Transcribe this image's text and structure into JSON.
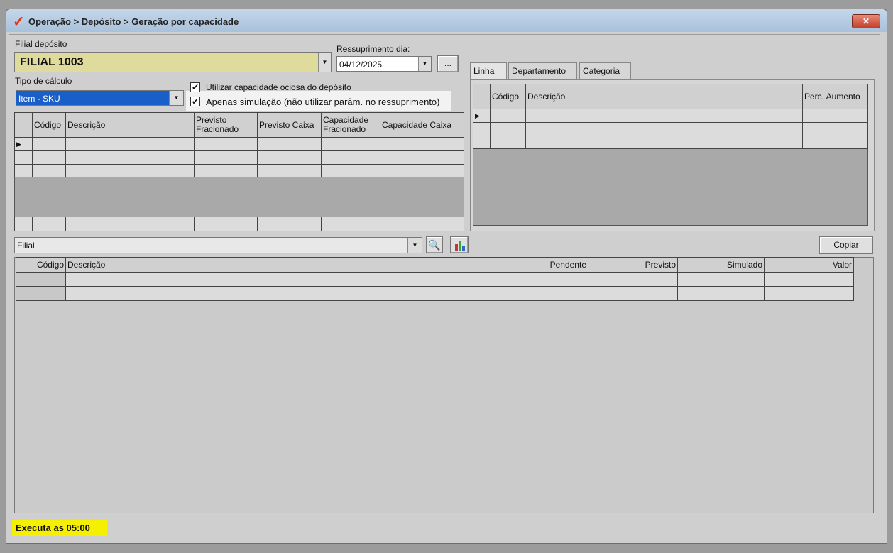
{
  "window": {
    "title": "Operação > Depósito > Geração por capacidade",
    "close": "✕"
  },
  "filial": {
    "label": "Filial depósito",
    "value": "FILIAL 1003"
  },
  "ressuprimento": {
    "label": "Ressuprimento dia:",
    "value": "04/12/2025",
    "button": "..."
  },
  "tipo": {
    "label": "Tipo de cálculo",
    "value": "Item - SKU"
  },
  "checks": [
    {
      "label": "Utilizar capacidade ociosa do depósito",
      "checked": true
    },
    {
      "label": "Apenas simulação (não utilizar parâm. no ressuprimento)",
      "checked": true
    }
  ],
  "grid1": {
    "headers": [
      "Código",
      "Descrição",
      "Previsto Fracionado",
      "Previsto Caixa",
      "Capacidade Fracionado",
      "Capacidade Caixa"
    ]
  },
  "tabs": [
    "Linha",
    "Departamento",
    "Categoria"
  ],
  "grid2": {
    "headers": [
      "Código",
      "Descrição",
      "Perc. Aumento"
    ]
  },
  "filter": {
    "value": "Filial",
    "copy": "Copiar"
  },
  "grid3": {
    "headers": [
      "Código",
      "Descrição",
      "Pendente",
      "Previsto",
      "Simulado",
      "Valor"
    ]
  },
  "status": "Executa as 05:00"
}
